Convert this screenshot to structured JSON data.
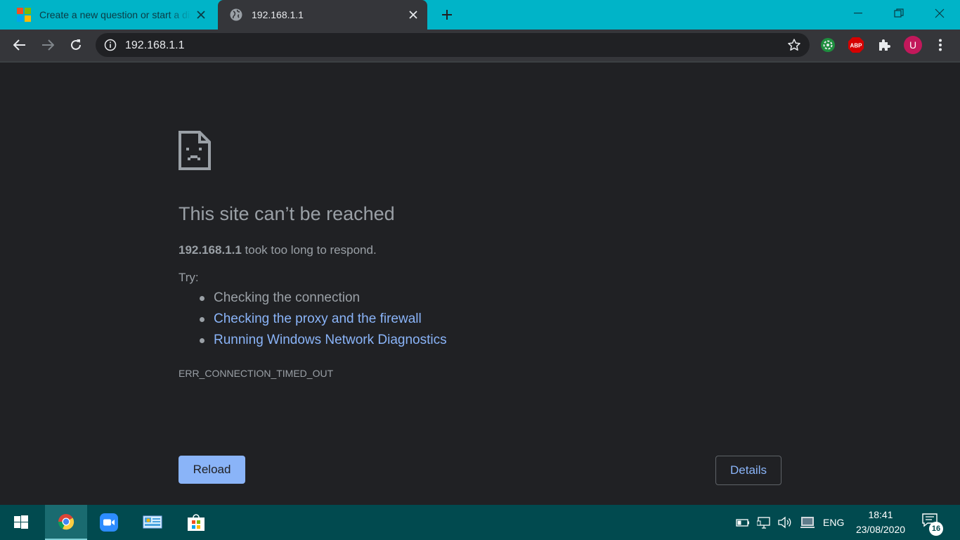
{
  "browser": {
    "tabs": [
      {
        "title": "Create a new question or start a discussion",
        "favicon": "microsoft-logo-icon",
        "active": false
      },
      {
        "title": "192.168.1.1",
        "favicon": "globe-icon",
        "active": true
      }
    ],
    "address_bar": {
      "url": "192.168.1.1"
    },
    "profile_initial": "U",
    "extension_abp_label": "ABP"
  },
  "error_page": {
    "heading": "This site can’t be reached",
    "host": "192.168.1.1",
    "message": " took too long to respond.",
    "try_label": "Try:",
    "suggestions": [
      {
        "text": "Checking the connection",
        "link": false
      },
      {
        "text": "Checking the proxy and the firewall",
        "link": true
      },
      {
        "text": "Running Windows Network Diagnostics",
        "link": true
      }
    ],
    "error_code": "ERR_CONNECTION_TIMED_OUT",
    "reload_label": "Reload",
    "details_label": "Details"
  },
  "taskbar": {
    "language": "ENG",
    "time": "18:41",
    "date": "23/08/2020",
    "notification_count": "16",
    "pinned": [
      "windows-start-icon",
      "chrome-icon",
      "zoom-icon",
      "control-panel-icon",
      "microsoft-store-icon"
    ]
  },
  "colors": {
    "tabstrip": "#00b4c8",
    "toolbar": "#35363a",
    "page_background": "#202124",
    "link": "#8ab4f8",
    "taskbar": "#014a4f",
    "profile_avatar": "#c2185b",
    "abp_badge": "#d50000"
  }
}
